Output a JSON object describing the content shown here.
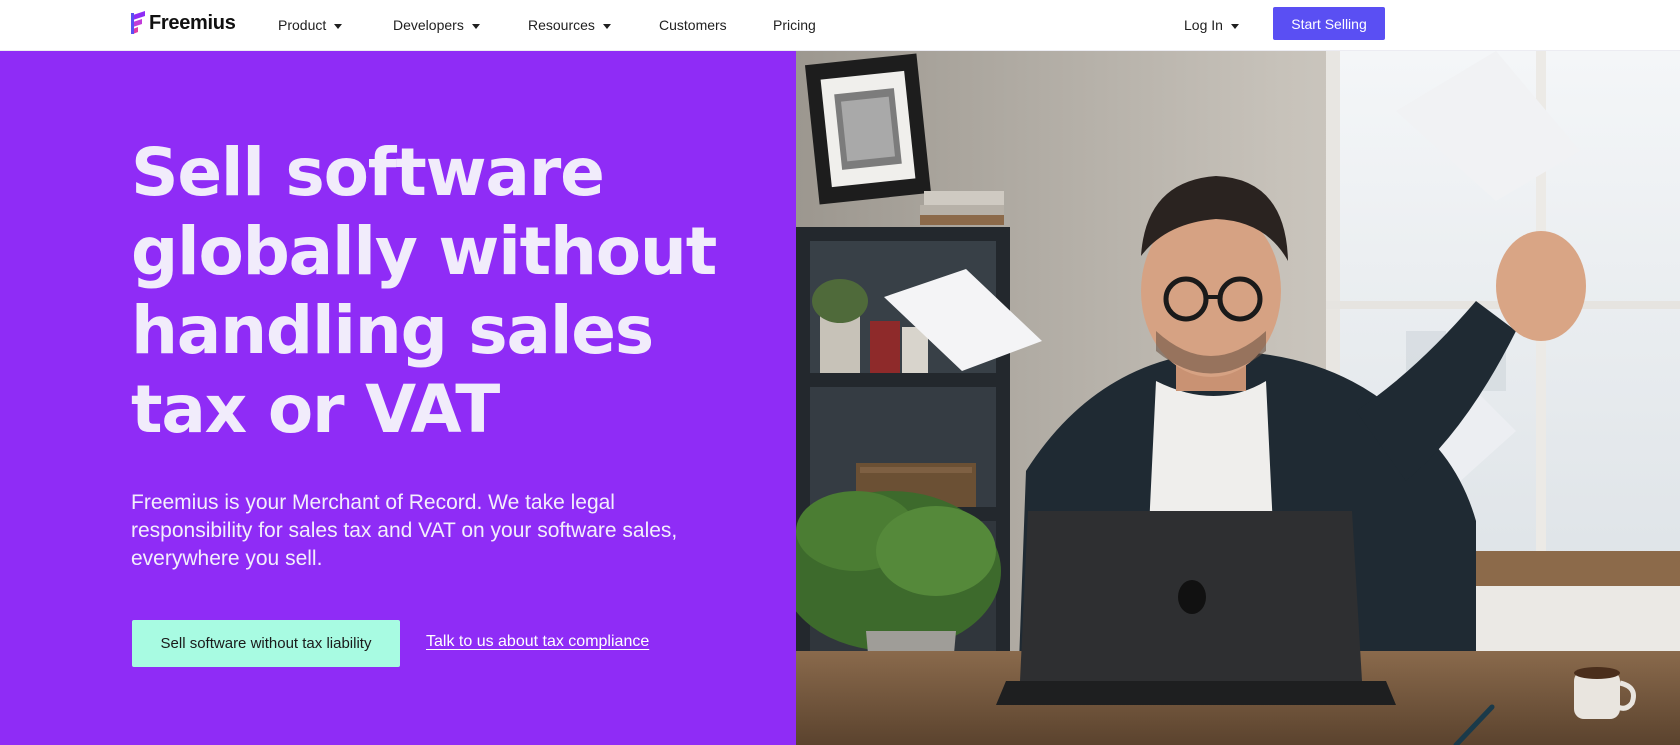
{
  "header": {
    "logo_text": "Freemius",
    "nav": [
      {
        "label": "Product",
        "has_dropdown": true,
        "icon": "chevron-down-icon"
      },
      {
        "label": "Developers",
        "has_dropdown": true,
        "icon": "chevron-down-icon"
      },
      {
        "label": "Resources",
        "has_dropdown": true,
        "icon": "chevron-down-icon"
      },
      {
        "label": "Customers",
        "has_dropdown": false
      },
      {
        "label": "Pricing",
        "has_dropdown": false
      }
    ],
    "login": {
      "label": "Log In",
      "has_dropdown": true,
      "icon": "chevron-down-icon"
    },
    "start_selling": "Start Selling"
  },
  "hero": {
    "headline_lines": [
      "Sell software",
      "globally without",
      "handling sales",
      "tax or VAT"
    ],
    "subtext_lines": [
      "Freemius is your Merchant of Record. We take legal",
      "responsibility for sales tax and VAT on your software sales,",
      "everywhere you sell."
    ],
    "cta_primary": "Sell software without tax liability",
    "cta_secondary": "Talk to us about tax compliance"
  },
  "colors": {
    "hero_background": "#8f2cf6",
    "headline": "#f1ecfb",
    "start_selling_button": "#5a4ff3",
    "cta_primary_button": "#a8fbe2",
    "logo_mark": "#8f2cf6"
  }
}
